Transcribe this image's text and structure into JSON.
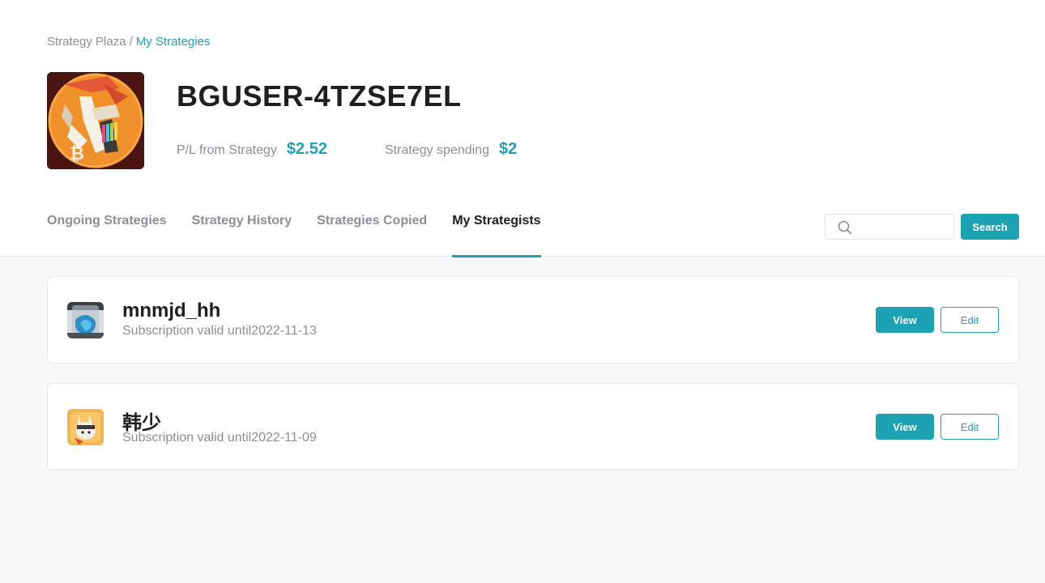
{
  "breadcrumb": {
    "root": "Strategy Plaza",
    "separator": "/",
    "current": "My Strategies"
  },
  "profile": {
    "username": "BGUSER-4TZSE7EL",
    "pl_label": "P/L from Strategy",
    "pl_value": "$2.52",
    "spending_label": "Strategy spending",
    "spending_value": "$2"
  },
  "tabs": [
    {
      "label": "Ongoing Strategies",
      "active": false
    },
    {
      "label": "Strategy History",
      "active": false
    },
    {
      "label": "Strategies Copied",
      "active": false
    },
    {
      "label": "My Strategists",
      "active": true
    }
  ],
  "search": {
    "value": "",
    "button_label": "Search",
    "icon": "search-icon"
  },
  "strategists": [
    {
      "name": "mnmjd_hh",
      "subscription": "Subscription valid until2022-11-13",
      "view_label": "View",
      "edit_label": "Edit"
    },
    {
      "name": "韩少",
      "subscription": "Subscription valid until2022-11-09",
      "view_label": "View",
      "edit_label": "Edit"
    }
  ],
  "colors": {
    "accent": "#1da2b4",
    "muted_text": "#8a8f99",
    "text": "#1f1f1f",
    "page_bg": "#f7f8fa"
  }
}
